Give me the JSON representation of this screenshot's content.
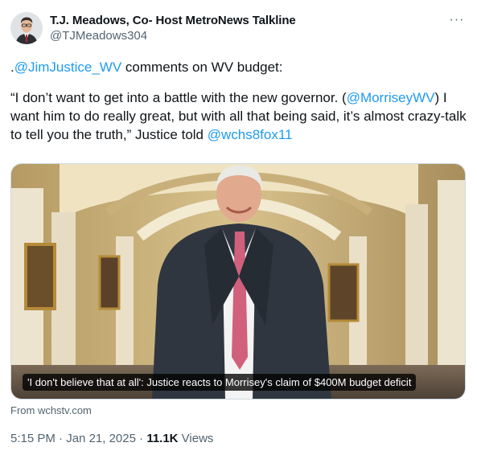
{
  "author": {
    "display_name": "T.J. Meadows, Co- Host MetroNews Talkline",
    "handle": "@TJMeadows304"
  },
  "more_menu_label": "···",
  "tweet": {
    "p1_prefix": ".",
    "p1_mention": "@JimJustice_WV",
    "p1_rest": " comments on WV budget:",
    "p2_part1": "“I don’t want to get into a battle with the new governor. (",
    "p2_mention1": "@MorriseyWV",
    "p2_part2": ") I want him to do really great, but with all that being said, it’s almost crazy-talk to tell you the truth,” Justice told ",
    "p2_mention2": "@wchs8fox11"
  },
  "card": {
    "caption": "'I don't believe that at all': Justice reacts to Morrisey's claim of $400M budget deficit",
    "source": "From wchstv.com"
  },
  "meta": {
    "time": "5:15 PM",
    "separator": " · ",
    "date": "Jan 21, 2025",
    "views_count": "11.1K",
    "views_label": " Views"
  }
}
